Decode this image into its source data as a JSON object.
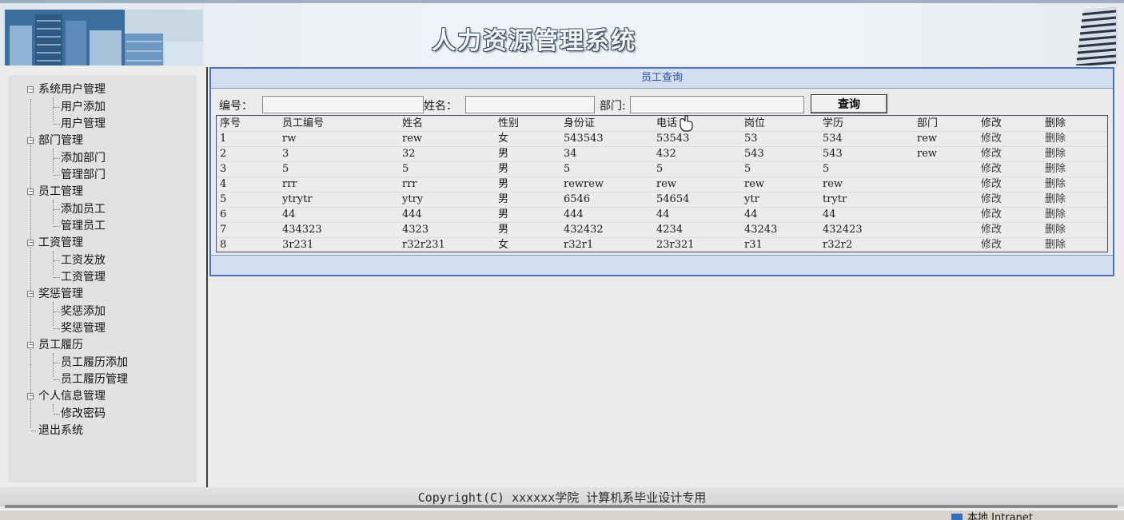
{
  "app": {
    "title": "人力资源管理系统"
  },
  "sidebar": {
    "groups": [
      {
        "label": "系统用户管理",
        "items": [
          "用户添加",
          "用户管理"
        ]
      },
      {
        "label": "部门管理",
        "items": [
          "添加部门",
          "管理部门"
        ]
      },
      {
        "label": "员工管理",
        "items": [
          "添加员工",
          "管理员工"
        ]
      },
      {
        "label": "工资管理",
        "items": [
          "工资发放",
          "工资管理"
        ]
      },
      {
        "label": "奖惩管理",
        "items": [
          "奖惩添加",
          "奖惩管理"
        ]
      },
      {
        "label": "员工履历",
        "items": [
          "员工履历添加",
          "员工履历管理"
        ]
      },
      {
        "label": "个人信息管理",
        "items": [
          "修改密码"
        ]
      }
    ],
    "exit_label": "退出系统"
  },
  "panel": {
    "title": "员工查询",
    "search": {
      "id_label": "编号：",
      "id_value": "",
      "name_label": "姓名：",
      "name_value": "",
      "dept_label": "部门:",
      "dept_value": "",
      "button_label": "查询"
    },
    "table": {
      "columns": [
        "序号",
        "员工编号",
        "姓名",
        "性别",
        "身份证",
        "电话",
        "岗位",
        "学历",
        "部门",
        "修改",
        "删除"
      ],
      "rows": [
        [
          "1",
          "rw",
          "rew",
          "女",
          "543543",
          "53543",
          "53",
          "534",
          "rew",
          "修改",
          "删除"
        ],
        [
          "2",
          "3",
          "32",
          "男",
          "34",
          "432",
          "543",
          "543",
          "rew",
          "修改",
          "删除"
        ],
        [
          "3",
          "5",
          "5",
          "男",
          "5",
          "5",
          "5",
          "5",
          "",
          "修改",
          "删除"
        ],
        [
          "4",
          "rrr",
          "rrr",
          "男",
          "rewrew",
          "rew",
          "rew",
          "rew",
          "",
          "修改",
          "删除"
        ],
        [
          "5",
          "ytrytr",
          "ytry",
          "男",
          "6546",
          "54654",
          "ytr",
          "trytr",
          "",
          "修改",
          "删除"
        ],
        [
          "6",
          "44",
          "444",
          "男",
          "444",
          "44",
          "44",
          "44",
          "",
          "修改",
          "删除"
        ],
        [
          "7",
          "434323",
          "4323",
          "男",
          "432432",
          "4234",
          "43243",
          "432423",
          "",
          "修改",
          "删除"
        ],
        [
          "8",
          "3r231",
          "r32r231",
          "女",
          "r32r1",
          "23r321",
          "r31",
          "r32r2",
          "",
          "修改",
          "删除"
        ]
      ]
    }
  },
  "footer": {
    "copyright": "Copyright(C) xxxxxx学院 计算机系毕业设计专用"
  },
  "statusbar": {
    "zone": "本地 Intranet"
  },
  "icons": {
    "banner_logo": "city-skyline-icon",
    "banner_building": "building-icon",
    "tree_toggle": "minus-box-icon",
    "cursor": "hand-pointer-icon"
  },
  "colors": {
    "panel_border": "#4c74b8",
    "panel_header_bg": "#d3dff0",
    "panel_title": "#2a55a0"
  }
}
